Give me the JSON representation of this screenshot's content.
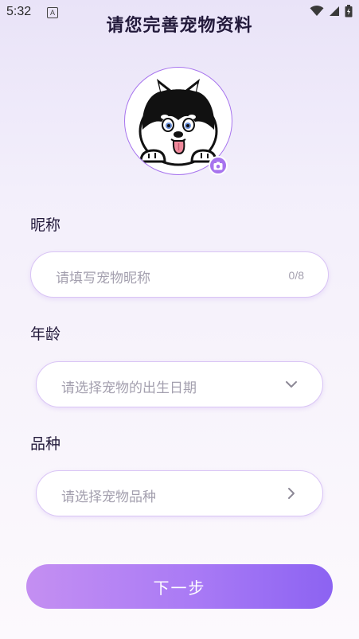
{
  "status_bar": {
    "time": "5:32",
    "notification_badge": "A"
  },
  "header": {
    "title": "请您完善宠物资料"
  },
  "avatar": {
    "icon": "husky-dog-avatar",
    "badge_icon": "camera-icon",
    "accent_color": "#a774ee"
  },
  "form": {
    "nickname": {
      "label": "昵称",
      "placeholder": "请填写宠物昵称",
      "value": "",
      "counter": "0/8"
    },
    "age": {
      "label": "年龄",
      "placeholder": "请选择宠物的出生日期",
      "value": "",
      "icon": "chevron-down-icon"
    },
    "breed": {
      "label": "品种",
      "placeholder": "请选择宠物品种",
      "value": "",
      "icon": "chevron-right-icon"
    }
  },
  "footer": {
    "next_label": "下一步"
  },
  "colors": {
    "accent": "#a774ee",
    "button_gradient_start": "#c48ff2",
    "button_gradient_end": "#8c63f2",
    "field_border": "#d9c4f5",
    "placeholder_text": "#a39fae",
    "title_text": "#231a3b"
  }
}
